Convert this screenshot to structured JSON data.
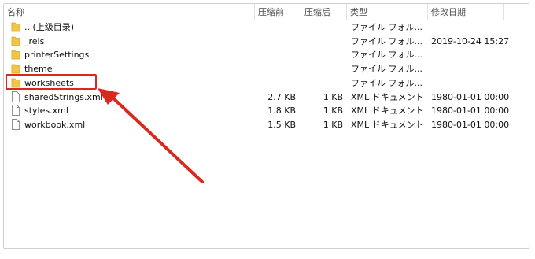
{
  "columns": {
    "name": "名称",
    "compressed": "压缩前",
    "original": "压缩后",
    "type": "类型",
    "modified": "修改日期"
  },
  "files": [
    {
      "name": ".. (上级目录)",
      "icon": "folder-icon",
      "compressed": "",
      "original": "",
      "type": "ファイル フォル...",
      "modified": ""
    },
    {
      "name": "_rels",
      "icon": "folder-icon",
      "compressed": "",
      "original": "",
      "type": "ファイル フォル...",
      "modified": "2019-10-24 15:27"
    },
    {
      "name": "printerSettings",
      "icon": "folder-icon",
      "compressed": "",
      "original": "",
      "type": "ファイル フォル...",
      "modified": ""
    },
    {
      "name": "theme",
      "icon": "folder-icon",
      "compressed": "",
      "original": "",
      "type": "ファイル フォル...",
      "modified": ""
    },
    {
      "name": "worksheets",
      "icon": "folder-icon",
      "compressed": "",
      "original": "",
      "type": "ファイル フォル...",
      "modified": ""
    },
    {
      "name": "sharedStrings.xml",
      "icon": "file-icon",
      "compressed": "2.7 KB",
      "original": "1 KB",
      "type": "XML ドキュメント",
      "modified": "1980-01-01 00:00"
    },
    {
      "name": "styles.xml",
      "icon": "file-icon",
      "compressed": "1.8 KB",
      "original": "1 KB",
      "type": "XML ドキュメント",
      "modified": "1980-01-01 00:00"
    },
    {
      "name": "workbook.xml",
      "icon": "file-icon",
      "compressed": "1.5 KB",
      "original": "1 KB",
      "type": "XML ドキュメント",
      "modified": "1980-01-01 00:00"
    }
  ],
  "colors": {
    "folder": "#f2c447",
    "annotation": "#d9281d"
  }
}
